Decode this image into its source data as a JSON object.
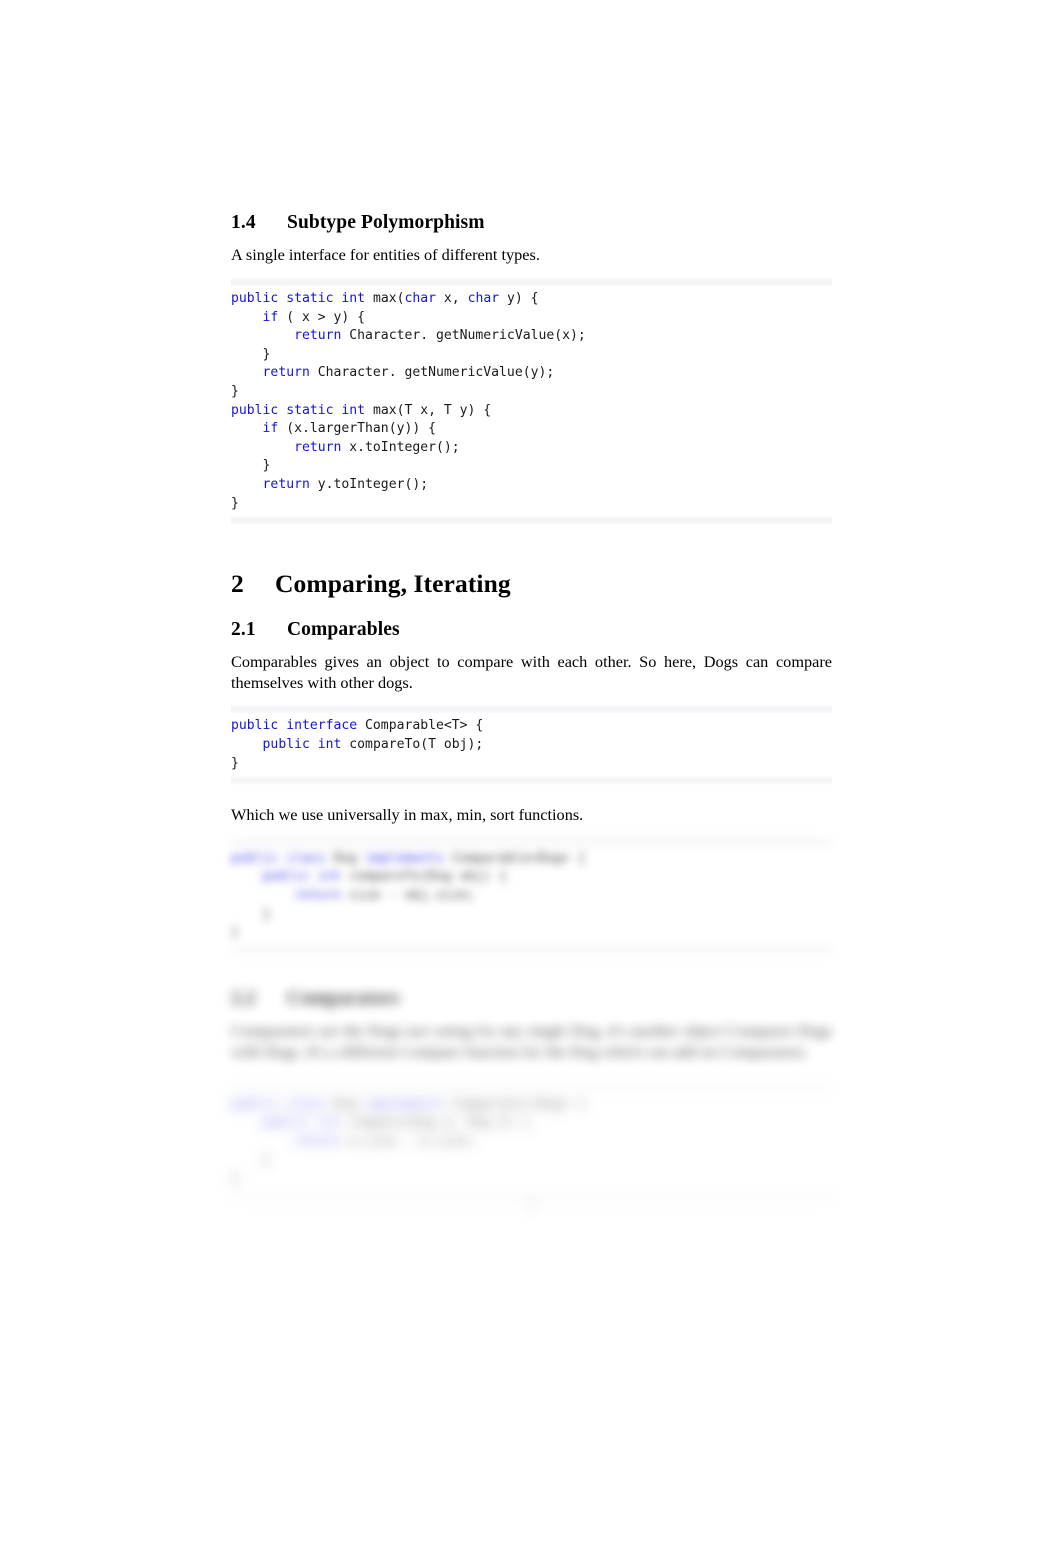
{
  "document": {
    "type": "lecture-notes",
    "page_number": "6",
    "background_color": "#ffffff",
    "keyword_color": "#1414e6",
    "text_color": "#000000"
  },
  "sections": {
    "subtype_polymorphism": {
      "number": "1.4",
      "title": "Subtype Polymorphism",
      "paragraph": "A single interface for entities of different types."
    },
    "comparing_iterating": {
      "number": "2",
      "title": "Comparing, Iterating"
    },
    "comparables": {
      "number": "2.1",
      "title": "Comparables",
      "paragraph": "Comparables gives an object to compare with each other. So here, Dogs can compare themselves with other dogs.",
      "paragraph_after": "Which we use universally in max, min, sort functions."
    },
    "comparators": {
      "number": "2.2",
      "title": "Comparators",
      "paragraph": "Comparators are the Dogs not caring for any single Dog, it's another object Compares Dogs with Dogs. It's a different Compare function for the Dog which can add on Comparators."
    }
  },
  "code_blocks": {
    "max_overloads": {
      "language": "java",
      "lines": [
        [
          {
            "t": "public",
            "k": true
          },
          {
            "t": " ",
            "k": false
          },
          {
            "t": "static",
            "k": true
          },
          {
            "t": " ",
            "k": false
          },
          {
            "t": "int",
            "k": true
          },
          {
            "t": " max(",
            "k": false
          },
          {
            "t": "char",
            "k": true
          },
          {
            "t": " x, ",
            "k": false
          },
          {
            "t": "char",
            "k": true
          },
          {
            "t": " y) {",
            "k": false
          }
        ],
        [
          {
            "t": "    ",
            "k": false
          },
          {
            "t": "if",
            "k": true
          },
          {
            "t": " ( x > y) {",
            "k": false
          }
        ],
        [
          {
            "t": "        ",
            "k": false
          },
          {
            "t": "return",
            "k": true
          },
          {
            "t": " Character. getNumericValue(x);",
            "k": false
          }
        ],
        [
          {
            "t": "    }",
            "k": false
          }
        ],
        [
          {
            "t": "    ",
            "k": false
          },
          {
            "t": "return",
            "k": true
          },
          {
            "t": " Character. getNumericValue(y);",
            "k": false
          }
        ],
        [
          {
            "t": "}",
            "k": false
          }
        ],
        [
          {
            "t": "public",
            "k": true
          },
          {
            "t": " ",
            "k": false
          },
          {
            "t": "static",
            "k": true
          },
          {
            "t": " ",
            "k": false
          },
          {
            "t": "int",
            "k": true
          },
          {
            "t": " max(T x, T y) {",
            "k": false
          }
        ],
        [
          {
            "t": "    ",
            "k": false
          },
          {
            "t": "if",
            "k": true
          },
          {
            "t": " (x.largerThan(y)) {",
            "k": false
          }
        ],
        [
          {
            "t": "        ",
            "k": false
          },
          {
            "t": "return",
            "k": true
          },
          {
            "t": " x.toInteger();",
            "k": false
          }
        ],
        [
          {
            "t": "    }",
            "k": false
          }
        ],
        [
          {
            "t": "    ",
            "k": false
          },
          {
            "t": "return",
            "k": true
          },
          {
            "t": " y.toInteger();",
            "k": false
          }
        ],
        [
          {
            "t": "}",
            "k": false
          }
        ]
      ]
    },
    "comparable_interface": {
      "language": "java",
      "lines": [
        [
          {
            "t": "public",
            "k": true
          },
          {
            "t": " ",
            "k": false
          },
          {
            "t": "interface",
            "k": true
          },
          {
            "t": " Comparable<T> {",
            "k": false
          }
        ],
        [
          {
            "t": "    ",
            "k": false
          },
          {
            "t": "public",
            "k": true
          },
          {
            "t": " ",
            "k": false
          },
          {
            "t": "int",
            "k": true
          },
          {
            "t": " compareTo(T obj);",
            "k": false
          }
        ],
        [
          {
            "t": "}",
            "k": false
          }
        ]
      ]
    },
    "comparable_dog_1": {
      "language": "java",
      "lines": [
        [
          {
            "t": "public",
            "k": true
          },
          {
            "t": " ",
            "k": false
          },
          {
            "t": "class",
            "k": true
          },
          {
            "t": " Dog ",
            "k": false
          },
          {
            "t": "implements",
            "k": true
          },
          {
            "t": " Comparable<Dog> {",
            "k": false
          }
        ],
        [
          {
            "t": "    ",
            "k": false
          },
          {
            "t": "public",
            "k": true
          },
          {
            "t": " ",
            "k": false
          },
          {
            "t": "int",
            "k": true
          },
          {
            "t": " compareTo(Dog obj) {",
            "k": false
          }
        ],
        [
          {
            "t": "        ",
            "k": false
          },
          {
            "t": "return",
            "k": true
          },
          {
            "t": " size - obj.size;",
            "k": false
          }
        ],
        [
          {
            "t": "    }",
            "k": false
          }
        ],
        [
          {
            "t": "}",
            "k": false
          }
        ]
      ]
    },
    "comparable_dog_2": {
      "language": "java",
      "lines": [
        [
          {
            "t": "public",
            "k": true
          },
          {
            "t": " ",
            "k": false
          },
          {
            "t": "class",
            "k": true
          },
          {
            "t": " Dog ",
            "k": false
          },
          {
            "t": "implements",
            "k": true
          },
          {
            "t": " Comparator<Dog> {",
            "k": false
          }
        ],
        [
          {
            "t": "    ",
            "k": false
          },
          {
            "t": "public",
            "k": true
          },
          {
            "t": " ",
            "k": false
          },
          {
            "t": "int",
            "k": true
          },
          {
            "t": " compare(Dog a, Dog b) {",
            "k": false
          }
        ],
        [
          {
            "t": "        ",
            "k": false
          },
          {
            "t": "return",
            "k": true
          },
          {
            "t": " a.size - b.size;",
            "k": false
          }
        ],
        [
          {
            "t": "    }",
            "k": false
          }
        ],
        [
          {
            "t": "}",
            "k": false
          }
        ]
      ]
    }
  }
}
